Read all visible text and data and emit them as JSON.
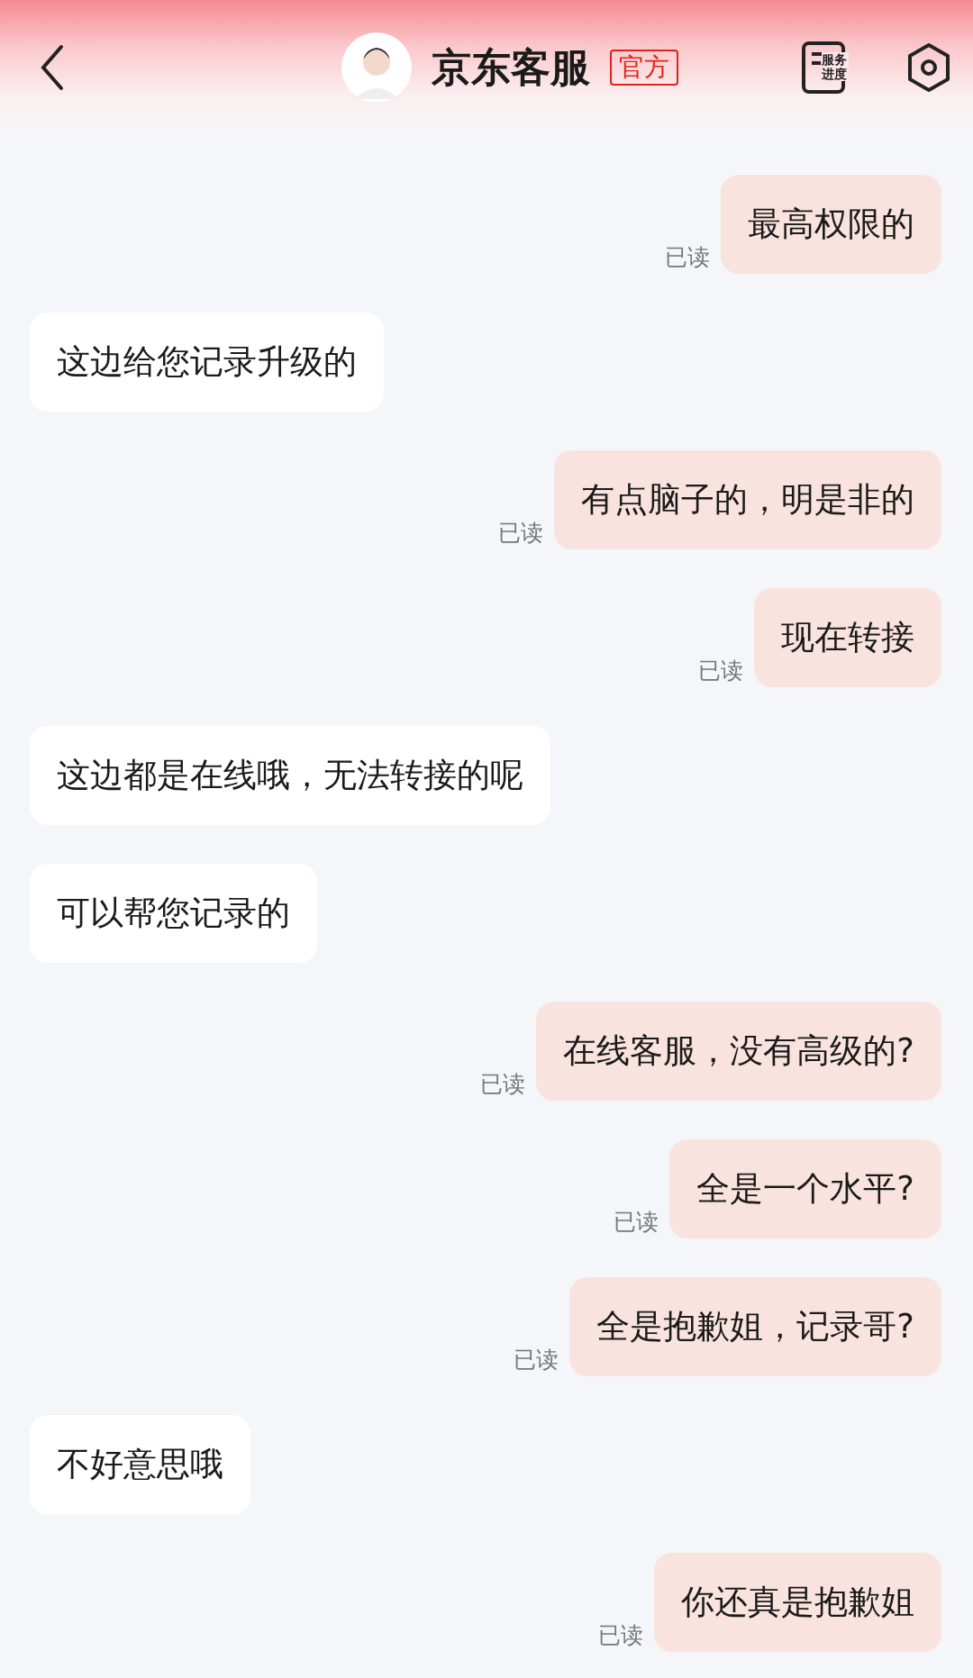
{
  "header": {
    "title": "京东客服",
    "badge": "官方",
    "service_label": "服务进度"
  },
  "messages": [
    {
      "kind": "sent",
      "text": "最高权限的",
      "status": "已读"
    },
    {
      "kind": "received",
      "text": "这边给您记录升级的"
    },
    {
      "kind": "sent",
      "text": "有点脑子的，明是非的",
      "status": "已读"
    },
    {
      "kind": "sent",
      "text": "现在转接",
      "status": "已读"
    },
    {
      "kind": "received",
      "text": "这边都是在线哦，无法转接的呢"
    },
    {
      "kind": "received",
      "text": "可以帮您记录的"
    },
    {
      "kind": "sent",
      "text": "在线客服，没有高级的?",
      "status": "已读"
    },
    {
      "kind": "sent",
      "text": "全是一个水平?",
      "status": "已读"
    },
    {
      "kind": "sent",
      "text": "全是抱歉姐，记录哥?",
      "status": "已读"
    },
    {
      "kind": "received",
      "text": "不好意思哦"
    },
    {
      "kind": "sent",
      "text": "你还真是抱歉姐",
      "status": "已读"
    }
  ]
}
